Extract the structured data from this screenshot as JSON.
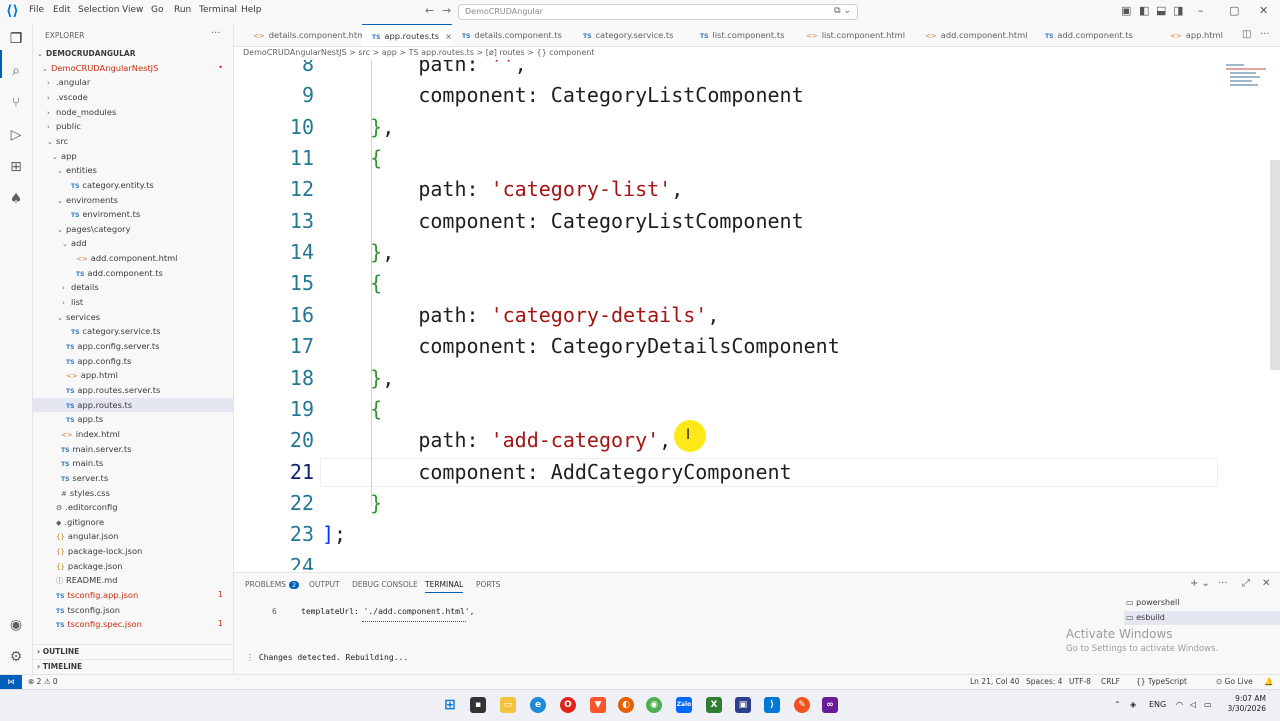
{
  "menu": [
    "File",
    "Edit",
    "Selection",
    "View",
    "Go",
    "Run",
    "Terminal",
    "Help"
  ],
  "search": {
    "text": "DemoCRUDAngular"
  },
  "sidebar": {
    "header": "EXPLORER",
    "items": [
      {
        "label": "DEMOCRUDANGULAR",
        "indent": 0,
        "chev": "⌄",
        "icon": "",
        "bold": true
      },
      {
        "label": "DemoCRUDAngularNestJS",
        "indent": 1,
        "chev": "⌄",
        "icon": "",
        "err": true,
        "badge": "•"
      },
      {
        "label": ".angular",
        "indent": 2,
        "chev": "›",
        "icon": ""
      },
      {
        "label": ".vscode",
        "indent": 2,
        "chev": "›",
        "icon": ""
      },
      {
        "label": "node_modules",
        "indent": 2,
        "chev": "›",
        "icon": ""
      },
      {
        "label": "public",
        "indent": 2,
        "chev": "›",
        "icon": ""
      },
      {
        "label": "src",
        "indent": 2,
        "chev": "⌄",
        "icon": ""
      },
      {
        "label": "app",
        "indent": 3,
        "chev": "⌄",
        "icon": ""
      },
      {
        "label": "entities",
        "indent": 4,
        "chev": "⌄",
        "icon": ""
      },
      {
        "label": "category.entity.ts",
        "indent": 5,
        "chev": "",
        "icon": "TS"
      },
      {
        "label": "enviroments",
        "indent": 4,
        "chev": "⌄",
        "icon": ""
      },
      {
        "label": "enviroment.ts",
        "indent": 5,
        "chev": "",
        "icon": "TS"
      },
      {
        "label": "pages\\category",
        "indent": 4,
        "chev": "⌄",
        "icon": ""
      },
      {
        "label": "add",
        "indent": 5,
        "chev": "⌄",
        "icon": ""
      },
      {
        "label": "add.component.html",
        "indent": 6,
        "chev": "",
        "icon": "<>"
      },
      {
        "label": "add.component.ts",
        "indent": 6,
        "chev": "",
        "icon": "TS"
      },
      {
        "label": "details",
        "indent": 5,
        "chev": "›",
        "icon": ""
      },
      {
        "label": "list",
        "indent": 5,
        "chev": "›",
        "icon": ""
      },
      {
        "label": "services",
        "indent": 4,
        "chev": "⌄",
        "icon": ""
      },
      {
        "label": "category.service.ts",
        "indent": 5,
        "chev": "",
        "icon": "TS"
      },
      {
        "label": "app.config.server.ts",
        "indent": 4,
        "chev": "",
        "icon": "TS"
      },
      {
        "label": "app.config.ts",
        "indent": 4,
        "chev": "",
        "icon": "TS"
      },
      {
        "label": "app.html",
        "indent": 4,
        "chev": "",
        "icon": "<>"
      },
      {
        "label": "app.routes.server.ts",
        "indent": 4,
        "chev": "",
        "icon": "TS"
      },
      {
        "label": "app.routes.ts",
        "indent": 4,
        "chev": "",
        "icon": "TS",
        "selected": true
      },
      {
        "label": "app.ts",
        "indent": 4,
        "chev": "",
        "icon": "TS"
      },
      {
        "label": "index.html",
        "indent": 3,
        "chev": "",
        "icon": "<>"
      },
      {
        "label": "main.server.ts",
        "indent": 3,
        "chev": "",
        "icon": "TS"
      },
      {
        "label": "main.ts",
        "indent": 3,
        "chev": "",
        "icon": "TS"
      },
      {
        "label": "server.ts",
        "indent": 3,
        "chev": "",
        "icon": "TS"
      },
      {
        "label": "styles.css",
        "indent": 3,
        "chev": "",
        "icon": "#"
      },
      {
        "label": ".editorconfig",
        "indent": 2,
        "chev": "",
        "icon": "⚙"
      },
      {
        "label": ".gitignore",
        "indent": 2,
        "chev": "",
        "icon": "◆"
      },
      {
        "label": "angular.json",
        "indent": 2,
        "chev": "",
        "icon": "{}"
      },
      {
        "label": "package-lock.json",
        "indent": 2,
        "chev": "",
        "icon": "{}"
      },
      {
        "label": "package.json",
        "indent": 2,
        "chev": "",
        "icon": "{}"
      },
      {
        "label": "README.md",
        "indent": 2,
        "chev": "",
        "icon": "ⓘ"
      },
      {
        "label": "tsconfig.app.json",
        "indent": 2,
        "chev": "",
        "icon": "TS",
        "err": true,
        "badge": "1"
      },
      {
        "label": "tsconfig.json",
        "indent": 2,
        "chev": "",
        "icon": "TS"
      },
      {
        "label": "tsconfig.spec.json",
        "indent": 2,
        "chev": "",
        "icon": "TS",
        "err": true,
        "badge": "1"
      }
    ],
    "outline": "OUTLINE",
    "timeline": "TIMELINE"
  },
  "tabs": [
    {
      "label": "details.component.html",
      "icon": "<>"
    },
    {
      "label": "app.routes.ts",
      "icon": "TS",
      "active": true,
      "close": "×"
    },
    {
      "label": "details.component.ts",
      "icon": "TS"
    },
    {
      "label": "category.service.ts",
      "icon": "TS"
    },
    {
      "label": "list.component.ts",
      "icon": "TS"
    },
    {
      "label": "list.component.html",
      "icon": "<>"
    },
    {
      "label": "add.component.html",
      "icon": "<>"
    },
    {
      "label": "add.component.ts",
      "icon": "TS"
    },
    {
      "label": "app.html",
      "icon": "<>"
    }
  ],
  "breadcrumb": "DemoCRUDAngularNestJS  >  src  >  app  >  TS app.routes.ts  >  [ø] routes  >  {} component",
  "editor": {
    "lines": [
      {
        "n": "8",
        "html": "        path: <span class=\"str\">''</span>,"
      },
      {
        "n": "9",
        "html": "        component: CategoryListComponent"
      },
      {
        "n": "10",
        "html": "    <span class=\"br2\">}</span>,"
      },
      {
        "n": "11",
        "html": "    <span class=\"br2\">{</span>"
      },
      {
        "n": "12",
        "html": "        path: <span class=\"str\">'category-list'</span>,"
      },
      {
        "n": "13",
        "html": "        component: CategoryListComponent"
      },
      {
        "n": "14",
        "html": "    <span class=\"br2\">}</span>,"
      },
      {
        "n": "15",
        "html": "    <span class=\"br2\">{</span>"
      },
      {
        "n": "16",
        "html": "        path: <span class=\"str\">'category-details'</span>,"
      },
      {
        "n": "17",
        "html": "        component: CategoryDetailsComponent"
      },
      {
        "n": "18",
        "html": "    <span class=\"br2\">}</span>,"
      },
      {
        "n": "19",
        "html": "    <span class=\"br2\">{</span>"
      },
      {
        "n": "20",
        "html": "        path: <span class=\"str\">'add-category'</span>,"
      },
      {
        "n": "21",
        "html": "        component: AddCategoryComponent",
        "current": true
      },
      {
        "n": "22",
        "html": "    <span class=\"br2\">}</span>"
      },
      {
        "n": "23",
        "html": "<span class=\"br1\">]</span>;"
      },
      {
        "n": "24",
        "html": ""
      }
    ]
  },
  "panel": {
    "tabs": [
      {
        "label": "PROBLEMS",
        "badge": "2"
      },
      {
        "label": "OUTPUT"
      },
      {
        "label": "DEBUG CONSOLE"
      },
      {
        "label": "TERMINAL",
        "active": true
      },
      {
        "label": "PORTS"
      }
    ],
    "terminal_line_no": "6",
    "terminal_code": "templateUrl: './add.component.html',",
    "terminal_status": "Changes detected. Rebuilding...",
    "terminals": [
      "powershell",
      "esbuild"
    ],
    "activate_title": "Activate Windows",
    "activate_sub": "Go to Settings to activate Windows."
  },
  "status": {
    "problems": "⊗ 2  ⚠ 0",
    "position": "Ln 21, Col 40",
    "spaces": "Spaces: 4",
    "encoding": "UTF-8",
    "eol": "CRLF",
    "language": "{} TypeScript",
    "golive": "⊙ Go Live"
  },
  "taskbar": {
    "lang": "ENG",
    "time": "9:07 AM",
    "date": "3/30/2026"
  },
  "colors": {
    "accent": "#005fb8",
    "string": "#a31515",
    "linenum": "#237893"
  }
}
